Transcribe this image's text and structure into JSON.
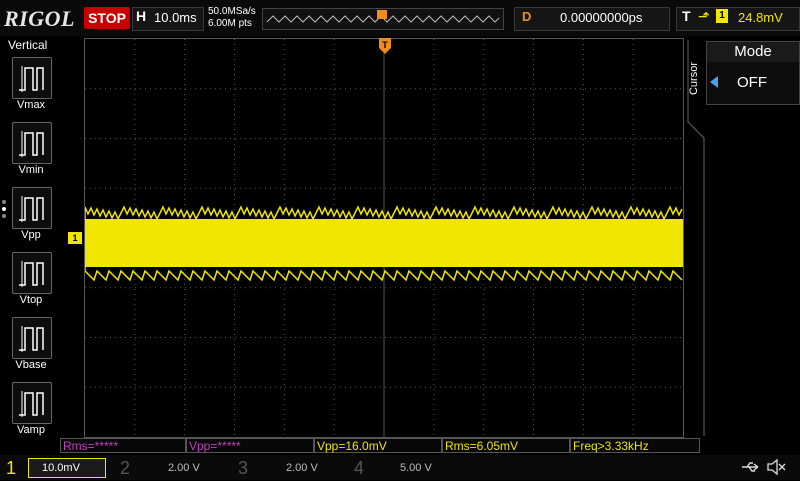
{
  "brand": "RIGOL",
  "run_state": "STOP",
  "horizontal": {
    "letter": "H",
    "timebase": "10.0ms",
    "sample_rate": "50.0MSa/s",
    "memory_depth": "6.00M pts"
  },
  "delay": {
    "letter": "D",
    "value": "0.00000000ps"
  },
  "trigger": {
    "letter": "T",
    "source": "1",
    "level": "24.8mV",
    "marker": "T"
  },
  "sidebar": {
    "title": "Vertical",
    "items": [
      {
        "label": "Vmax"
      },
      {
        "label": "Vmin"
      },
      {
        "label": "Vpp"
      },
      {
        "label": "Vtop"
      },
      {
        "label": "Vbase"
      },
      {
        "label": "Vamp"
      }
    ]
  },
  "channel_marker": "1",
  "cursor_menu": {
    "title": "Cursor",
    "mode_label": "Mode",
    "mode_value": "OFF"
  },
  "measurements": [
    {
      "text": "Rms=*****",
      "color": "#c040c0"
    },
    {
      "text": "Vpp=*****",
      "color": "#c040c0"
    },
    {
      "text": "Vpp=16.0mV",
      "color": "#f0e600"
    },
    {
      "text": "Rms=6.05mV",
      "color": "#f0e600"
    },
    {
      "text": "Freq>3.33kHz",
      "color": "#f0e600"
    }
  ],
  "channels": [
    {
      "num": "1",
      "scale": "10.0mV",
      "color": "#f0e600"
    },
    {
      "num": "2",
      "scale": "2.00 V",
      "color": "#00c0c0"
    },
    {
      "num": "3",
      "scale": "2.00 V",
      "color": "#c040c0"
    },
    {
      "num": "4",
      "scale": "5.00 V",
      "color": "#4a7ad8"
    }
  ],
  "colors": {
    "ch1": "#f0e600",
    "grid": "#555555",
    "stop": "#c80000",
    "accent": "#f08c1e"
  },
  "icons": [
    "usb-icon",
    "speaker-mute-icon"
  ]
}
